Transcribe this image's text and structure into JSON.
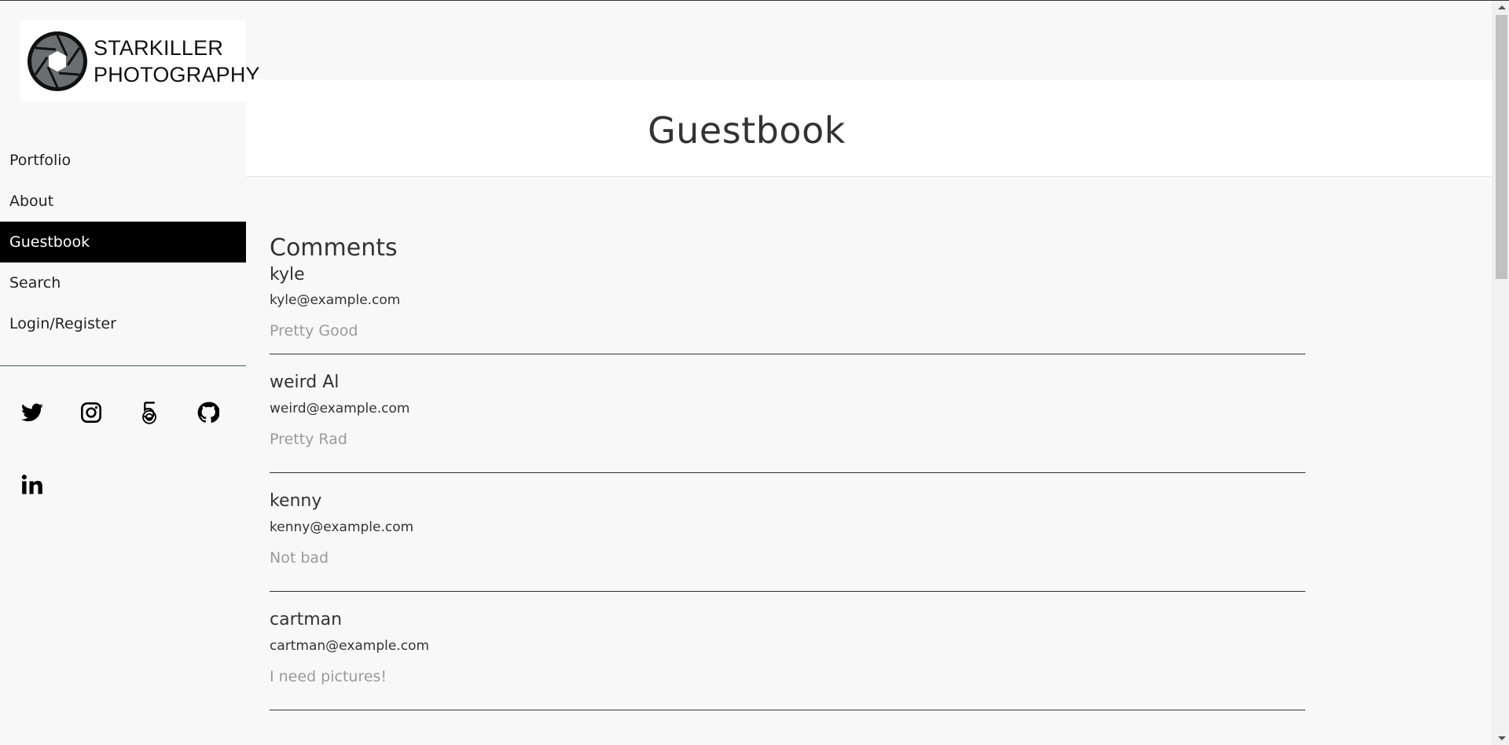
{
  "brand": {
    "line1": "STARKILLER",
    "line2": "PHOTOGRAPHY"
  },
  "nav": {
    "items": [
      {
        "label": "Portfolio",
        "active": false
      },
      {
        "label": "About",
        "active": false
      },
      {
        "label": "Guestbook",
        "active": true
      },
      {
        "label": "Search",
        "active": false
      },
      {
        "label": "Login/Register",
        "active": false
      }
    ]
  },
  "social": [
    "twitter-icon",
    "instagram-icon",
    "500px-icon",
    "github-icon",
    "linkedin-icon"
  ],
  "header": {
    "title": "Guestbook"
  },
  "comments": {
    "heading": "Comments",
    "items": [
      {
        "name": "kyle",
        "email": "kyle@example.com",
        "text": "Pretty Good"
      },
      {
        "name": "weird Al",
        "email": "weird@example.com",
        "text": "Pretty Rad"
      },
      {
        "name": "kenny",
        "email": "kenny@example.com",
        "text": "Not bad"
      },
      {
        "name": "cartman",
        "email": "cartman@example.com",
        "text": "I need pictures!"
      }
    ]
  },
  "colors": {
    "active_nav_bg": "#000000",
    "page_bg": "#f8f8f8",
    "muted_text": "#9a9a9a"
  }
}
